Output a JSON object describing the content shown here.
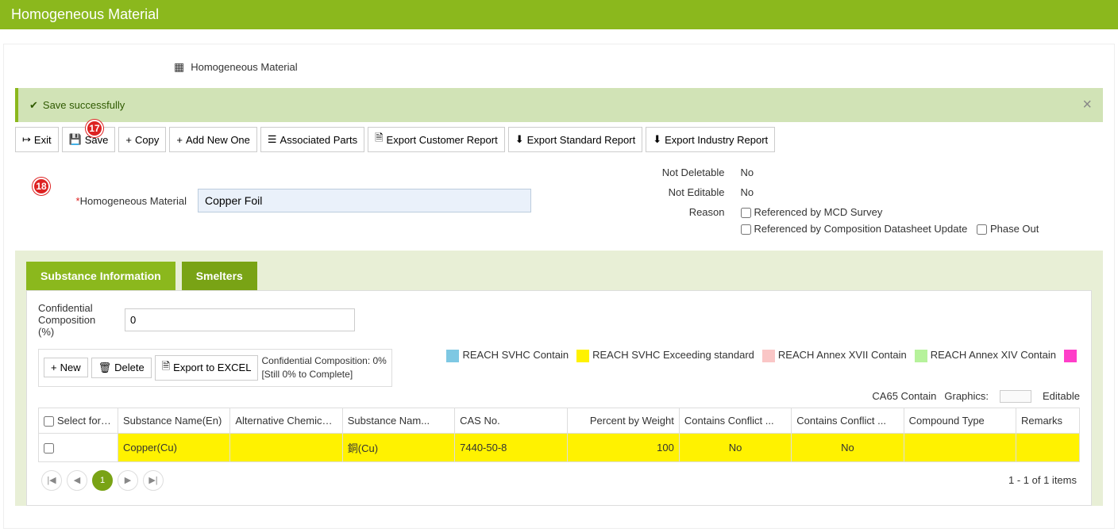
{
  "header": {
    "title": "Homogeneous Material"
  },
  "breadcrumb": {
    "label": "Homogeneous Material"
  },
  "alert": {
    "message": "Save successfully"
  },
  "badges": {
    "b17": "17",
    "b18": "18"
  },
  "toolbar": {
    "exit": "Exit",
    "save": "Save",
    "copy": "Copy",
    "add_new": "Add New One",
    "assoc_parts": "Associated Parts",
    "export_customer": "Export Customer Report",
    "export_standard": "Export Standard Report",
    "export_industry": "Export Industry Report"
  },
  "form": {
    "material_label": "Homogeneous Material",
    "material_value": "Copper Foil",
    "not_deletable_label": "Not Deletable",
    "not_deletable_value": "No",
    "not_editable_label": "Not Editable",
    "not_editable_value": "No",
    "reason_label": "Reason",
    "reason_mcd": "Referenced by MCD Survey",
    "reason_comp": "Referenced by Composition Datasheet Update",
    "reason_phase": "Phase Out"
  },
  "tabs": {
    "sub_info": "Substance Information",
    "smelters": "Smelters"
  },
  "conf": {
    "label": "Confidential Composition (%)",
    "value": "0"
  },
  "tools": {
    "new": "New",
    "delete": "Delete",
    "excel": "Export to EXCEL"
  },
  "conf_note": {
    "line1": "Confidential Composition: 0%",
    "line2": "[Still 0% to Complete]"
  },
  "legend": {
    "svhc_contain": "REACH SVHC Contain",
    "svhc_exceed": "REACH SVHC Exceeding standard",
    "annex17": "REACH Annex XVII Contain",
    "annex14": "REACH Annex XIV Contain",
    "ca65": "CA65 Contain",
    "graphics": "Graphics:",
    "editable": "Editable",
    "colors": {
      "svhc_contain": "#7EC8E3",
      "svhc_exceed": "#FFF200",
      "annex17": "#FAC6C6",
      "annex14": "#B6F29B",
      "ca65": "#FF3EC9"
    }
  },
  "table": {
    "cols": {
      "sel": "Select for de...",
      "name_en": "Substance Name(En)",
      "alt_name": "Alternative Chemical Name",
      "name_other": "Substance Nam...",
      "cas": "CAS No.",
      "pct": "Percent by Weight",
      "conflict1": "Contains Conflict ...",
      "conflict2": "Contains Conflict ...",
      "compound": "Compound Type",
      "remarks": "Remarks"
    },
    "rows": [
      {
        "name_en": "Copper(Cu)",
        "alt_name": "",
        "name_other": "銅(Cu)",
        "cas": "7440-50-8",
        "pct": "100",
        "conflict1": "No",
        "conflict2": "No",
        "compound": "",
        "remarks": ""
      }
    ]
  },
  "pager": {
    "page": "1",
    "summary": "1 - 1 of 1 items"
  }
}
